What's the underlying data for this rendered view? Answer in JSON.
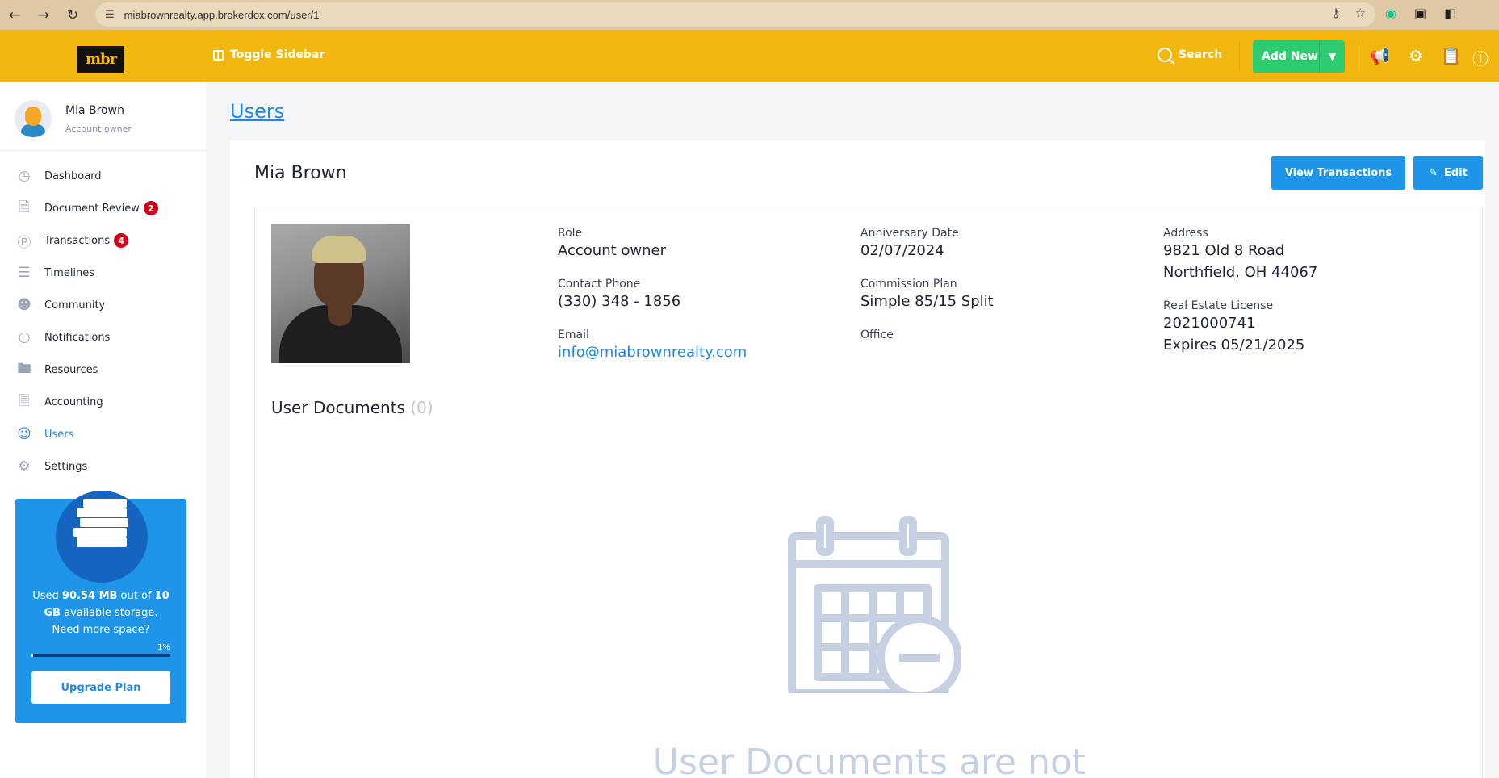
{
  "browser": {
    "url": "miabrownrealty.app.brokerdox.com/user/1"
  },
  "header": {
    "logo_text": "mbr",
    "toggle_label": "Toggle Sidebar",
    "search_label": "Search",
    "add_new_label": "Add New",
    "accent": "#f2b70f",
    "green": "#2ecc71"
  },
  "sidebar": {
    "user_name": "Mia Brown",
    "user_role": "Account owner",
    "items": [
      {
        "label": "Dashboard",
        "icon": "gauge-icon"
      },
      {
        "label": "Document Review",
        "icon": "document-icon",
        "badge": "2"
      },
      {
        "label": "Transactions",
        "icon": "dollar-icon",
        "badge": "4"
      },
      {
        "label": "Timelines",
        "icon": "timeline-icon"
      },
      {
        "label": "Community",
        "icon": "people-icon"
      },
      {
        "label": "Notifications",
        "icon": "chat-icon"
      },
      {
        "label": "Resources",
        "icon": "folder-icon"
      },
      {
        "label": "Accounting",
        "icon": "ledger-icon"
      },
      {
        "label": "Users",
        "icon": "user-icon"
      },
      {
        "label": "Settings",
        "icon": "gear-icon"
      }
    ],
    "storage": {
      "used_prefix": "Used ",
      "used": "90.54 MB",
      "mid": " out of ",
      "total": "10 GB",
      "suffix": " available storage.",
      "prompt": "Need more space?",
      "percent_label": "1%",
      "percent": 1,
      "upgrade_label": "Upgrade Plan"
    }
  },
  "main": {
    "breadcrumb": "Users",
    "title": "Mia Brown",
    "view_transactions_label": "View Transactions",
    "edit_label": "Edit",
    "fields": {
      "role_label": "Role",
      "role": "Account owner",
      "phone_label": "Contact Phone",
      "phone": "(330) 348 - 1856",
      "email_label": "Email",
      "email": "info@miabrownrealty.com",
      "anniversary_label": "Anniversary Date",
      "anniversary": "02/07/2024",
      "commission_label": "Commission Plan",
      "commission": "Simple 85/15 Split",
      "office_label": "Office",
      "address_label": "Address",
      "address_line1": "9821 Old 8 Road",
      "address_line2": "Northfield, OH 44067",
      "license_label": "Real Estate License",
      "license_number": "2021000741",
      "license_expiry": "Expires 05/21/2025"
    },
    "documents": {
      "title": "User Documents",
      "count": "(0)",
      "empty_message": "User Documents are not"
    }
  }
}
